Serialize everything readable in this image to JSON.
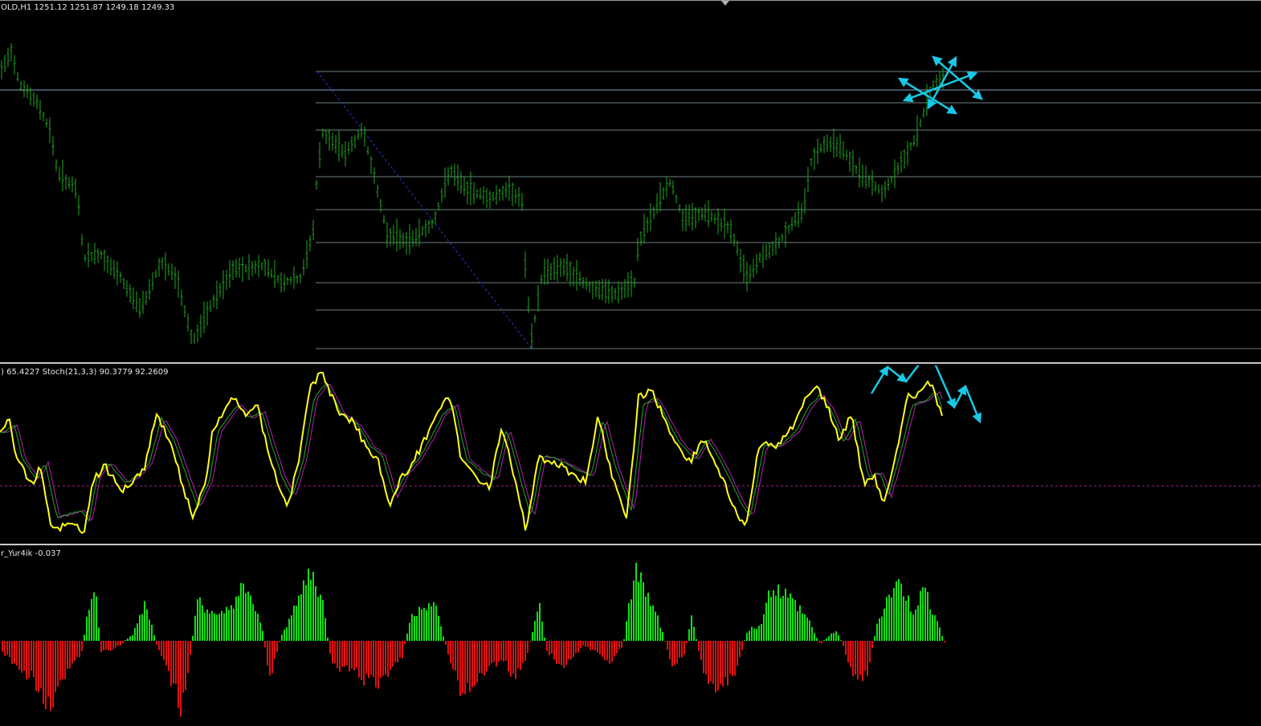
{
  "window": {
    "price_header": "OLD,H1  1251.12 1251.87 1249.18 1249.33",
    "stoch_header": ") 65.4227  Stoch(21,3,3) 90.3779 92.2609",
    "hist_header": "r_Yur4ik -0.037"
  },
  "colors": {
    "background": "#000000",
    "candles": "#1fa81f",
    "fib_levels": "#6f7f7f",
    "fib_diagonal": "#1f2fbf",
    "annotation_arrows": "#19c8e6",
    "stoch_main": "#ffff1a",
    "stoch_signal_1": "#1fae1f",
    "stoch_signal_2": "#b81fb8",
    "stoch_mid_line": "#a8207f",
    "hist_positive": "#11e011",
    "hist_negative": "#e01111"
  },
  "icons": [
    "scroll-marker-icon",
    "arrow-annotation-icon"
  ]
}
